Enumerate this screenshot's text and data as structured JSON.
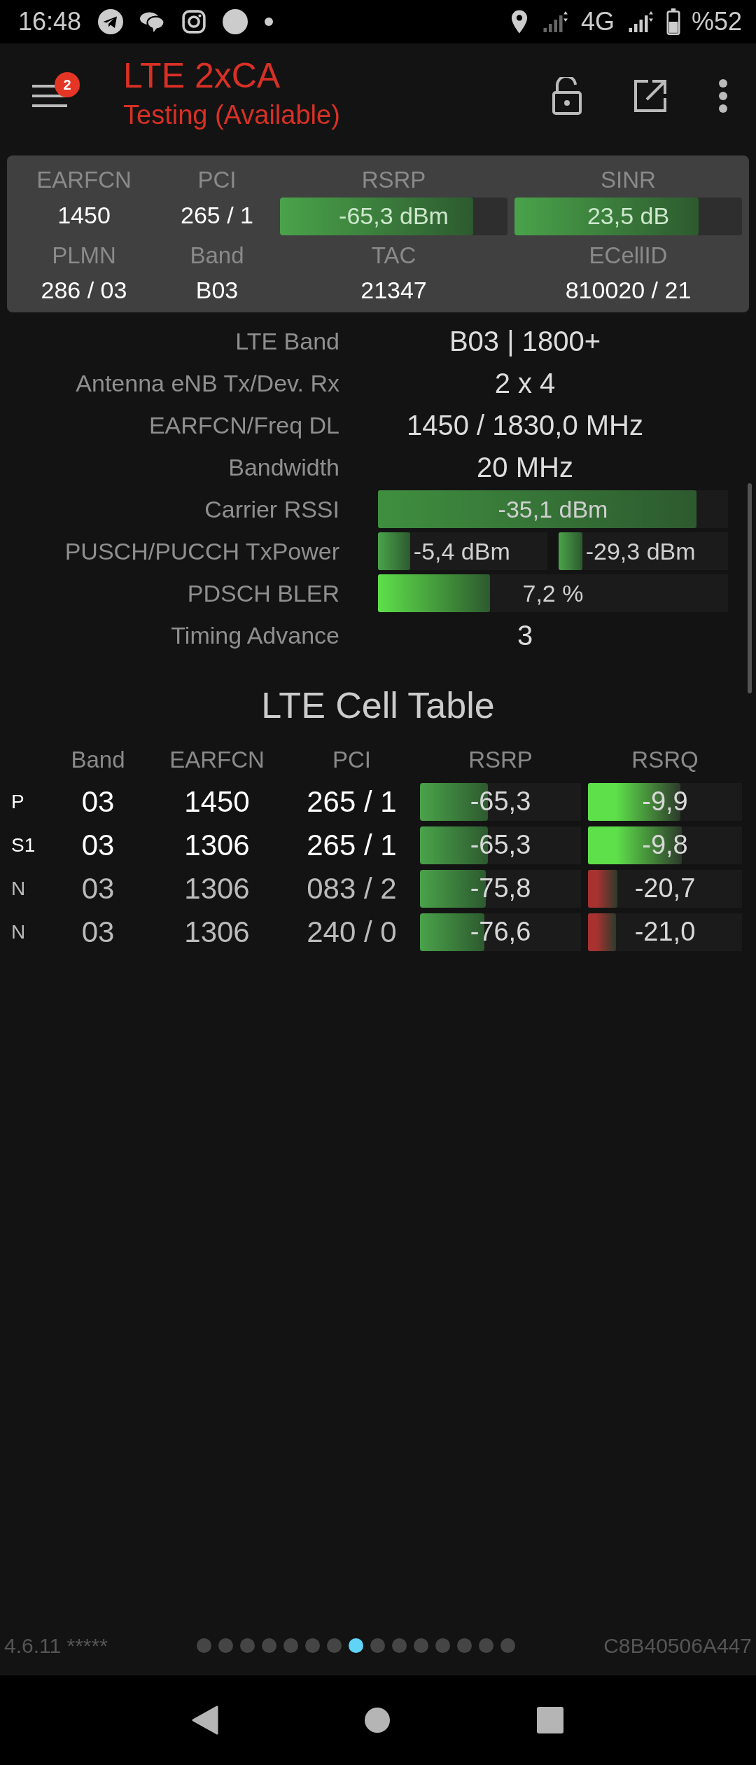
{
  "status_bar": {
    "time": "16:48",
    "network": "4G",
    "battery": "%52"
  },
  "app_bar": {
    "badge": "2",
    "title": "LTE 2xCA",
    "subtitle": "Testing (Available)"
  },
  "summary": {
    "rows": [
      [
        {
          "label": "EARFCN",
          "value": "1450"
        },
        {
          "label": "PCI",
          "value": "265 / 1"
        },
        {
          "label": "RSRP",
          "value": "-65,3 dBm",
          "level": 0.85
        },
        {
          "label": "SINR",
          "value": "23,5 dB",
          "level": 0.81
        }
      ],
      [
        {
          "label": "PLMN",
          "value": "286 / 03"
        },
        {
          "label": "Band",
          "value": "B03"
        },
        {
          "label": "TAC",
          "value": "21347"
        },
        {
          "label": "ECellID",
          "value": "810020 / 21"
        }
      ]
    ]
  },
  "details": [
    {
      "kind": "text",
      "label": "LTE Band",
      "value": "B03 | 1800+"
    },
    {
      "kind": "text",
      "label": "Antenna eNB Tx/Dev. Rx",
      "value": "2 x 4"
    },
    {
      "kind": "text",
      "label": "EARFCN/Freq DL",
      "value": "1450 / 1830,0 MHz"
    },
    {
      "kind": "text",
      "label": "Bandwidth",
      "value": "20 MHz"
    },
    {
      "kind": "bar",
      "label": "Carrier RSSI",
      "value": "-35,1 dBm",
      "level": 0.91,
      "color": "#3f8f3f"
    },
    {
      "kind": "dual_bar",
      "label": "PUSCH/PUCCH TxPower",
      "bars": [
        {
          "value": "-5,4 dBm",
          "level": 0.19
        },
        {
          "value": "-29,3 dBm",
          "level": 0.14
        }
      ]
    },
    {
      "kind": "bar",
      "label": "PDSCH BLER",
      "value": "7,2 %",
      "level": 0.32,
      "color": "#5ee04a"
    },
    {
      "kind": "text",
      "label": "Timing Advance",
      "value": "3"
    }
  ],
  "cell_table": {
    "title": "LTE Cell Table",
    "columns": [
      "Band",
      "EARFCN",
      "PCI",
      "RSRP",
      "RSRQ"
    ],
    "rows": [
      {
        "type": "P",
        "serving": true,
        "band": "03",
        "earfcn": "1450",
        "pci": "265 / 1",
        "rsrp": {
          "value": "-65,3",
          "level": 0.42
        },
        "rsrq": {
          "value": "-9,9",
          "level": 0.6,
          "color": "#5ee04a"
        }
      },
      {
        "type": "S1",
        "serving": true,
        "band": "03",
        "earfcn": "1306",
        "pci": "265 / 1",
        "rsrp": {
          "value": "-65,3",
          "level": 0.42
        },
        "rsrq": {
          "value": "-9,8",
          "level": 0.61,
          "color": "#5ee04a"
        }
      },
      {
        "type": "N",
        "serving": false,
        "band": "03",
        "earfcn": "1306",
        "pci": "083 / 2",
        "rsrp": {
          "value": "-75,8",
          "level": 0.41
        },
        "rsrq": {
          "value": "-20,7",
          "level": 0.19,
          "color": "#a83230"
        }
      },
      {
        "type": "N",
        "serving": false,
        "band": "03",
        "earfcn": "1306",
        "pci": "240 / 0",
        "rsrp": {
          "value": "-76,6",
          "level": 0.4
        },
        "rsrq": {
          "value": "-21,0",
          "level": 0.18,
          "color": "#a83230"
        }
      }
    ]
  },
  "footer": {
    "version": "4.6.11 *****",
    "device_id": "C8B40506A447",
    "page_dots": [
      {
        "selected": false
      },
      {
        "selected": false
      },
      {
        "selected": false
      },
      {
        "selected": false
      },
      {
        "selected": false
      },
      {
        "selected": false
      },
      {
        "selected": false
      },
      {
        "selected": true
      },
      {
        "selected": false
      },
      {
        "selected": false
      },
      {
        "selected": false
      },
      {
        "selected": false
      },
      {
        "selected": false
      },
      {
        "selected": false
      },
      {
        "selected": false
      }
    ]
  }
}
